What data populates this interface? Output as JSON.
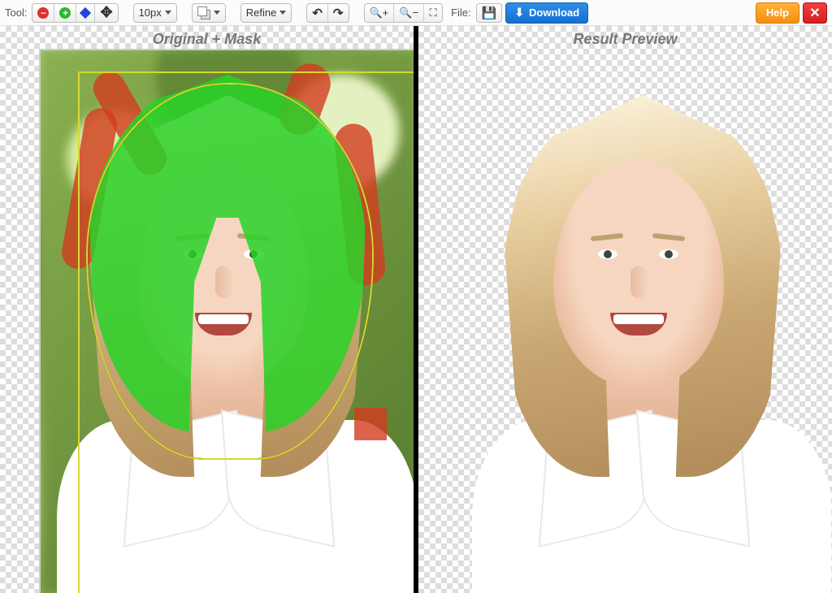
{
  "toolbar": {
    "tool_label": "Tool:",
    "brush_size": "10px",
    "refine_label": "Refine",
    "file_label": "File:",
    "download_label": "Download",
    "help_label": "Help"
  },
  "panes": {
    "left_title": "Original + Mask",
    "right_title": "Result Preview"
  }
}
